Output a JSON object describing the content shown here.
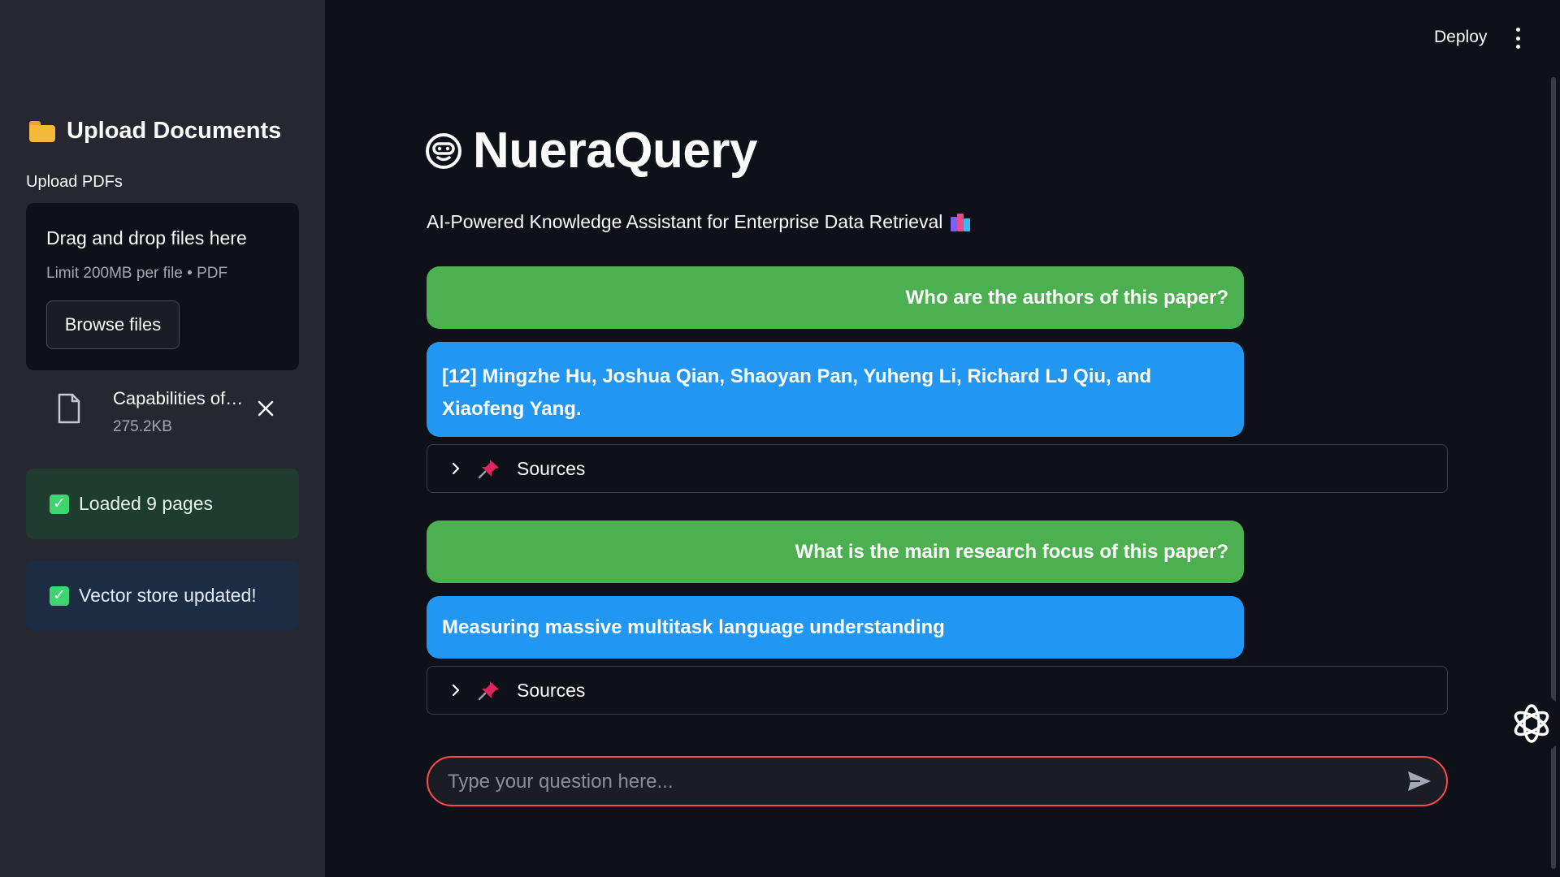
{
  "topbar": {
    "deploy_label": "Deploy",
    "menu_icon": "kebab-menu-icon"
  },
  "sidebar": {
    "header_icon": "folder-icon",
    "header": "Upload Documents",
    "upload_label": "Upload PDFs",
    "dropzone": {
      "title": "Drag and drop files here",
      "limit": "Limit 200MB per file • PDF",
      "browse_label": "Browse files"
    },
    "file": {
      "icon": "file-icon",
      "name": "Capabilities of…",
      "size": "275.2KB"
    },
    "alerts": [
      {
        "text": "Loaded 9 pages",
        "color": "#1f3d2e"
      },
      {
        "text": "Vector store updated!",
        "color": "#1c2c43"
      }
    ]
  },
  "main": {
    "title_icon": "bot-face-icon",
    "title": "NueraQuery",
    "subtitle": "AI-Powered Knowledge Assistant for Enterprise Data Retrieval",
    "subtitle_icon": "books-icon",
    "messages": [
      {
        "role": "user",
        "text": "Who are the authors of this paper?"
      },
      {
        "role": "assistant",
        "text": "[12] Mingzhe Hu, Joshua Qian, Shaoyan Pan, Yuheng Li, Richard LJ Qiu, and Xiaofeng Yang."
      },
      {
        "role": "sources",
        "text": "Sources"
      },
      {
        "role": "user",
        "text": "What is the main research focus of this paper?"
      },
      {
        "role": "assistant",
        "text": "Measuring massive multitask language understanding"
      },
      {
        "role": "sources",
        "text": "Sources"
      }
    ],
    "input": {
      "placeholder": "Type your question here..."
    }
  },
  "colors": {
    "user_bubble": "#4caf50",
    "assistant_bubble": "#2196f3",
    "accent": "#ff4b4b",
    "background": "#0e1117",
    "sidebar": "#262730"
  }
}
